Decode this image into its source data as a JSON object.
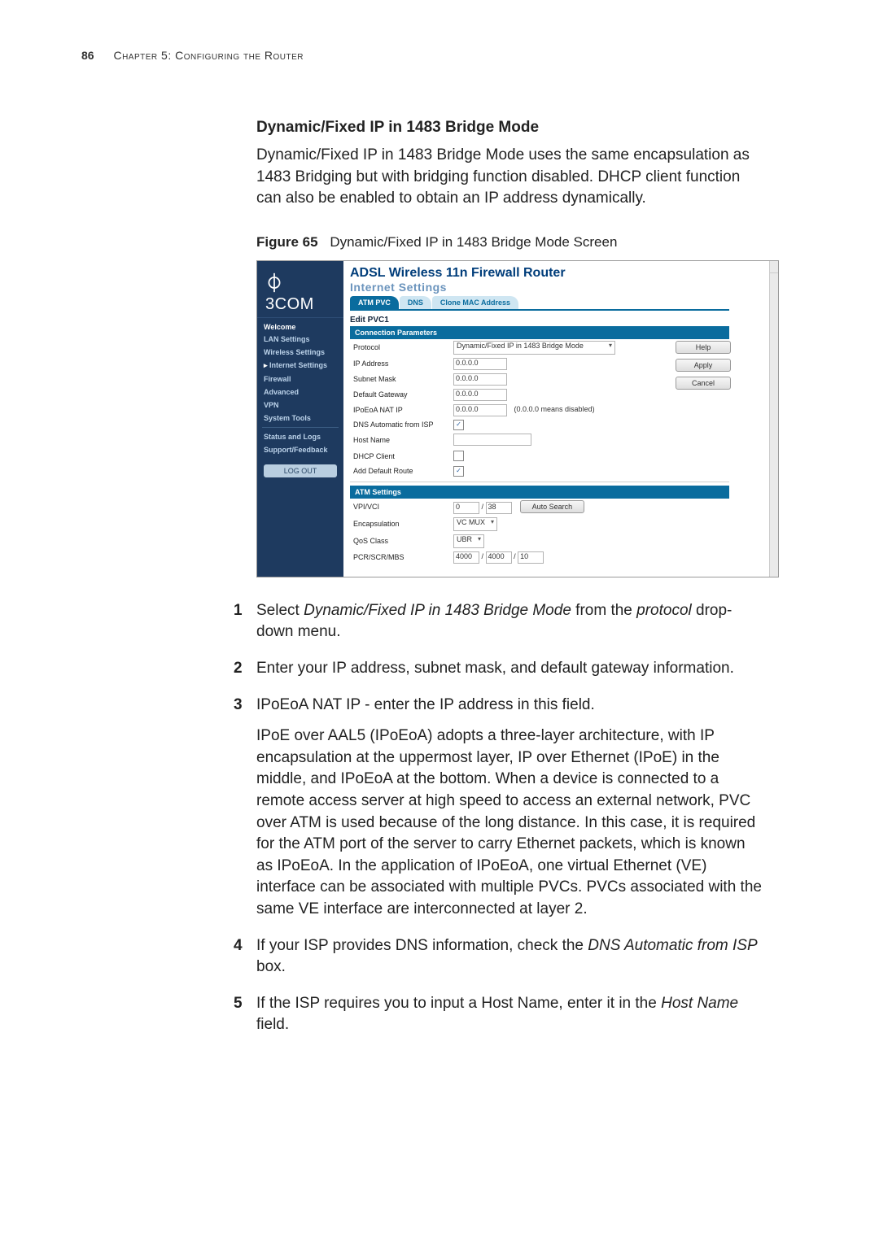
{
  "runhead": {
    "page_number": "86",
    "chapter": "Chapter 5: Configuring the Router"
  },
  "section": {
    "title": "Dynamic/Fixed IP in 1483 Bridge Mode",
    "intro": "Dynamic/Fixed IP in 1483 Bridge Mode uses the same encapsulation as 1483 Bridging but with bridging function disabled. DHCP client function can also be enabled to obtain an IP address dynamically."
  },
  "figure": {
    "label": "Figure 65",
    "caption": "Dynamic/Fixed IP in 1483 Bridge Mode Screen"
  },
  "ui": {
    "brand_swirl": "⏀",
    "brand": "3COM",
    "router_title": "ADSL Wireless 11n Firewall Router",
    "subtitle": "Internet Settings",
    "tabs": {
      "atm": "ATM PVC",
      "dns": "DNS",
      "clone": "Clone MAC Address"
    },
    "nav": {
      "welcome": "Welcome",
      "lan": "LAN Settings",
      "wireless": "Wireless Settings",
      "internet": "Internet Settings",
      "firewall": "Firewall",
      "advanced": "Advanced",
      "vpn": "VPN",
      "system": "System Tools",
      "status": "Status and Logs",
      "support": "Support/Feedback",
      "logout": "LOG OUT"
    },
    "edit_pvc": "Edit PVC1",
    "conn_hdr": "Connection Parameters",
    "labels": {
      "protocol": "Protocol",
      "ip": "IP Address",
      "mask": "Subnet Mask",
      "gw": "Default Gateway",
      "nat": "IPoEoA NAT IP",
      "dnsauto": "DNS Automatic from ISP",
      "host": "Host Name",
      "dhcp": "DHCP Client",
      "defroute": "Add Default Route"
    },
    "values": {
      "protocol": "Dynamic/Fixed IP in 1483 Bridge Mode",
      "ip": "0.0.0.0",
      "mask": "0.0.0.0",
      "gw": "0.0.0.0",
      "nat": "0.0.0.0",
      "host": ""
    },
    "nat_hint": "(0.0.0.0 means disabled)",
    "atm_hdr": "ATM Settings",
    "atm_labels": {
      "vpi": "VPI/VCI",
      "encap": "Encapsulation",
      "qos": "QoS Class",
      "pcr": "PCR/SCR/MBS"
    },
    "atm_values": {
      "vpi": "0",
      "vci": "38",
      "encap": "VC MUX",
      "qos": "UBR",
      "pcr": "4000",
      "scr": "4000",
      "mbs": "10"
    },
    "buttons": {
      "help": "Help",
      "apply": "Apply",
      "cancel": "Cancel",
      "autosearch": "Auto Search"
    },
    "slashes": {
      "s": "/"
    }
  },
  "steps": {
    "s1a": "Select ",
    "s1i": "Dynamic/Fixed IP in 1483 Bridge Mode",
    "s1b": " from the ",
    "s1i2": "protocol",
    "s1c": " drop-down menu.",
    "s2": "Enter your IP address, subnet mask, and default gateway information.",
    "s3": "IPoEoA NAT IP - enter the IP address in this field.",
    "s3p": "IPoE over AAL5 (IPoEoA) adopts a three-layer architecture, with IP encapsulation at the uppermost layer, IP over Ethernet (IPoE) in the middle, and IPoEoA at the bottom. When a device is connected to a remote access server at high speed to access an external network, PVC over ATM is used because of the long distance. In this case, it is required for the ATM port of the server to carry Ethernet packets, which is known as IPoEoA. In the application of IPoEoA, one virtual Ethernet (VE) interface can be associated with multiple PVCs. PVCs associated with the same VE interface are interconnected at layer 2.",
    "s4a": "If your ISP provides DNS information, check the ",
    "s4i": "DNS Automatic from ISP",
    "s4b": " box.",
    "s5a": "If the ISP requires you to input a Host Name, enter it in the ",
    "s5i": "Host Name",
    "s5b": " field."
  },
  "nums": {
    "n1": "1",
    "n2": "2",
    "n3": "3",
    "n4": "4",
    "n5": "5"
  }
}
